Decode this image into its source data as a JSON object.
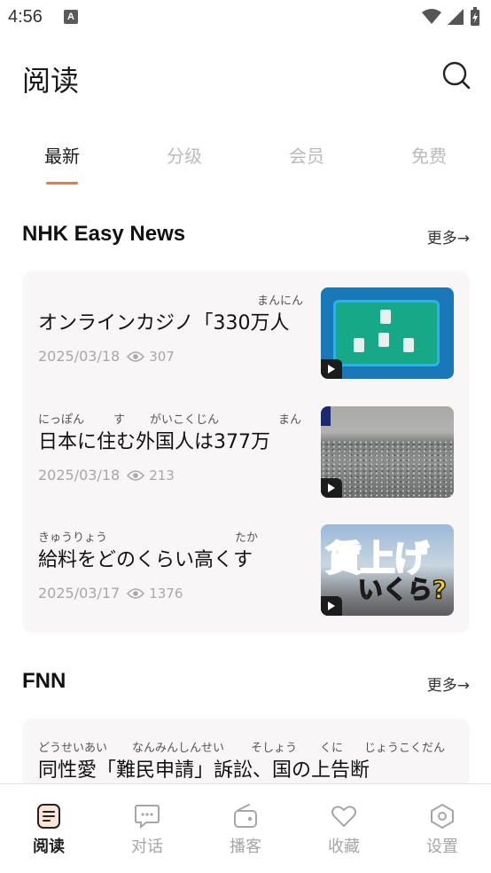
{
  "status_bar": {
    "time": "4:56",
    "a_icon": "A"
  },
  "header": {
    "title": "阅读",
    "search_icon": "search-icon"
  },
  "tabs": [
    {
      "label": "最新",
      "active": true
    },
    {
      "label": "分级",
      "active": false
    },
    {
      "label": "会员",
      "active": false
    },
    {
      "label": "免费",
      "active": false
    }
  ],
  "sections": [
    {
      "title": "NHK Easy News",
      "more": "更多→",
      "articles": [
        {
          "ruby": [
            "まんにん"
          ],
          "title": "オンラインカジノ「330万人",
          "date": "2025/03/18",
          "views": "307"
        },
        {
          "ruby": [
            "にっぽん",
            "す",
            "がいこくじん",
            "まん"
          ],
          "title": "日本に住む外国人は377万",
          "date": "2025/03/18",
          "views": "213"
        },
        {
          "ruby": [
            "きゅうりょう",
            "たか"
          ],
          "title": "給料をどのくらい高くす",
          "date": "2025/03/17",
          "views": "1376"
        }
      ]
    },
    {
      "title": "FNN",
      "more": "更多→",
      "articles": [
        {
          "ruby": [
            "どうせいあい",
            "なんみんしんせい",
            "そしょう",
            "くに",
            "じょうこくだん"
          ],
          "title": "同性愛「難民申請」訴訟、国の上告断"
        }
      ]
    }
  ],
  "thumbnails": {
    "wage_line1": "賃上げ",
    "wage_line2": "いくら?"
  },
  "bottom_nav": [
    {
      "label": "阅读",
      "icon": "reading-icon",
      "active": true
    },
    {
      "label": "对话",
      "icon": "chat-icon",
      "active": false
    },
    {
      "label": "播客",
      "icon": "radio-icon",
      "active": false
    },
    {
      "label": "收藏",
      "icon": "heart-icon",
      "active": false
    },
    {
      "label": "设置",
      "icon": "settings-icon",
      "active": false
    }
  ],
  "colors": {
    "accent": "#e07c52",
    "card_bg": "#f8f6f6",
    "inactive": "#bbbbbb"
  }
}
